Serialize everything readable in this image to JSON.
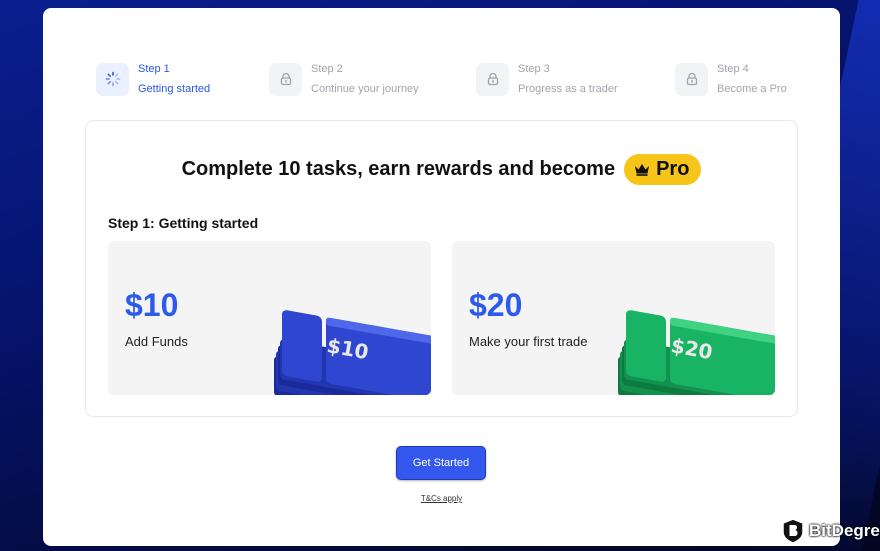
{
  "steps": [
    {
      "num": "Step 1",
      "label": "Getting started",
      "icon": "spinner-icon",
      "active": true
    },
    {
      "num": "Step 2",
      "label": "Continue your journey",
      "icon": "lock-icon",
      "active": false
    },
    {
      "num": "Step 3",
      "label": "Progress as a trader",
      "icon": "lock-icon",
      "active": false
    },
    {
      "num": "Step 4",
      "label": "Become a Pro",
      "icon": "lock-icon",
      "active": false
    }
  ],
  "panel": {
    "headline": "Complete 10 tasks, earn rewards and become",
    "badge": "Pro",
    "badge_icon": "crown-icon",
    "subhead": "Step 1: Getting started"
  },
  "rewards": [
    {
      "amount": "$10",
      "label": "Add Funds",
      "ticket_text": "$10",
      "color": "#2d45c8"
    },
    {
      "amount": "$20",
      "label": "Make your first trade",
      "ticket_text": "$20",
      "color": "#18b060"
    }
  ],
  "cta": {
    "label": "Get Started"
  },
  "terms": "T&Cs apply",
  "watermark": {
    "text": "BitDegree"
  },
  "colors": {
    "accent": "#3458ee",
    "badge": "#f7c419",
    "amount": "#2d5be9"
  }
}
